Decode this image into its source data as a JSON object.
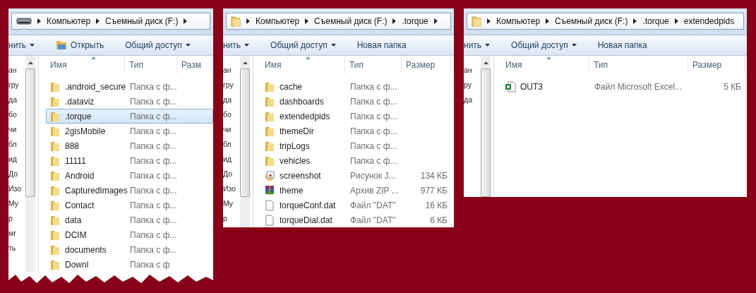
{
  "windows": [
    {
      "address": {
        "kind": "drive",
        "crumbs": [
          "Компьютер",
          "Съемный диск (F:)"
        ],
        "trailing_arrow": true
      },
      "toolbar": [
        {
          "label": "нить",
          "kind": "menu"
        },
        {
          "label": "Открыть",
          "kind": "open"
        },
        {
          "label": "Общий доступ",
          "kind": "menu"
        }
      ],
      "nav_fragments": [
        "ан",
        "гру",
        "да",
        "бо",
        "чи",
        "бл",
        "ид",
        "До",
        "Изо",
        "Му",
        "р",
        "мг",
        "ть"
      ],
      "columns": [
        "Имя",
        "Тип",
        "Разм"
      ],
      "torn": true,
      "files": [
        {
          "name": ".android_secure",
          "type": "Папка с ф...",
          "kind": "folder",
          "selected": false
        },
        {
          "name": ".dataviz",
          "type": "Папка с ф...",
          "kind": "folder",
          "selected": false
        },
        {
          "name": ".torque",
          "type": "Папка с ф...",
          "kind": "folder",
          "selected": true
        },
        {
          "name": "2gisMobile",
          "type": "Папка с ф...",
          "kind": "folder",
          "selected": false
        },
        {
          "name": "888",
          "type": "Папка с ф...",
          "kind": "folder",
          "selected": false
        },
        {
          "name": "11111",
          "type": "Папка с ф...",
          "kind": "folder",
          "selected": false
        },
        {
          "name": "Android",
          "type": "Папка с ф...",
          "kind": "folder",
          "selected": false
        },
        {
          "name": "CapturedImages",
          "type": "Папка с ф...",
          "kind": "folder",
          "selected": false
        },
        {
          "name": "Contact",
          "type": "Папка с ф...",
          "kind": "folder",
          "selected": false
        },
        {
          "name": "data",
          "type": "Папка с ф...",
          "kind": "folder",
          "selected": false
        },
        {
          "name": "DCIM",
          "type": "Папка с ф...",
          "kind": "folder",
          "selected": false
        },
        {
          "name": "documents",
          "type": "Папка с ф...",
          "kind": "folder",
          "selected": false
        },
        {
          "name": "Downl",
          "type": "Папка с ф",
          "kind": "folder",
          "selected": false
        }
      ]
    },
    {
      "address": {
        "kind": "folder",
        "crumbs": [
          "Компьютер",
          "Съемный диск (F:)",
          ".torque"
        ],
        "trailing_arrow": true
      },
      "toolbar": [
        {
          "label": "нить",
          "kind": "menu"
        },
        {
          "label": "Общий доступ",
          "kind": "menu"
        },
        {
          "label": "Новая папка",
          "kind": "plain"
        }
      ],
      "nav_fragments": [
        "ан",
        "гру",
        "да",
        "бо",
        "чи",
        "бл",
        "ид",
        "До",
        "Изо",
        "Му",
        "р"
      ],
      "columns": [
        "Имя",
        "Тип",
        "Размер"
      ],
      "torn": false,
      "files": [
        {
          "name": "cache",
          "type": "Папка с ф...",
          "kind": "folder",
          "selected": false
        },
        {
          "name": "dashboards",
          "type": "Папка с ф...",
          "kind": "folder",
          "selected": false
        },
        {
          "name": "extendedpids",
          "type": "Папка с ф...",
          "kind": "folder",
          "selected": false
        },
        {
          "name": "themeDir",
          "type": "Папка с ф...",
          "kind": "folder",
          "selected": false
        },
        {
          "name": "tripLogs",
          "type": "Папка с ф...",
          "kind": "folder",
          "selected": false
        },
        {
          "name": "vehicles",
          "type": "Папка с ф...",
          "kind": "folder",
          "selected": false
        },
        {
          "name": "screenshot",
          "type": "Рисунок J...",
          "size": "134 КБ",
          "kind": "image",
          "selected": false
        },
        {
          "name": "theme",
          "type": "Архив ZIP ...",
          "size": "977 КБ",
          "kind": "archive",
          "selected": false
        },
        {
          "name": "torqueConf.dat",
          "type": "Файл \"DAT\"",
          "size": "16 КБ",
          "kind": "file",
          "selected": false
        },
        {
          "name": "torqueDial.dat",
          "type": "Файл \"DAT\"",
          "size": "6 КБ",
          "kind": "file",
          "selected": false
        }
      ]
    },
    {
      "address": {
        "kind": "folder",
        "crumbs": [
          "Компьютер",
          "Съемный диск (F:)",
          ".torque",
          "extendedpids"
        ],
        "trailing_arrow": false
      },
      "toolbar": [
        {
          "label": "нить",
          "kind": "menu"
        },
        {
          "label": "Общий доступ",
          "kind": "menu"
        },
        {
          "label": "Новая папка",
          "kind": "plain"
        }
      ],
      "nav_fragments": [
        "ан",
        "ру",
        "да"
      ],
      "columns": [
        "Имя",
        "Тип",
        "Размер"
      ],
      "torn": false,
      "files": [
        {
          "name": "OUT3",
          "type": "Файл Microsoft Excel...",
          "size": "5 КБ",
          "kind": "excel",
          "selected": false
        }
      ]
    }
  ]
}
